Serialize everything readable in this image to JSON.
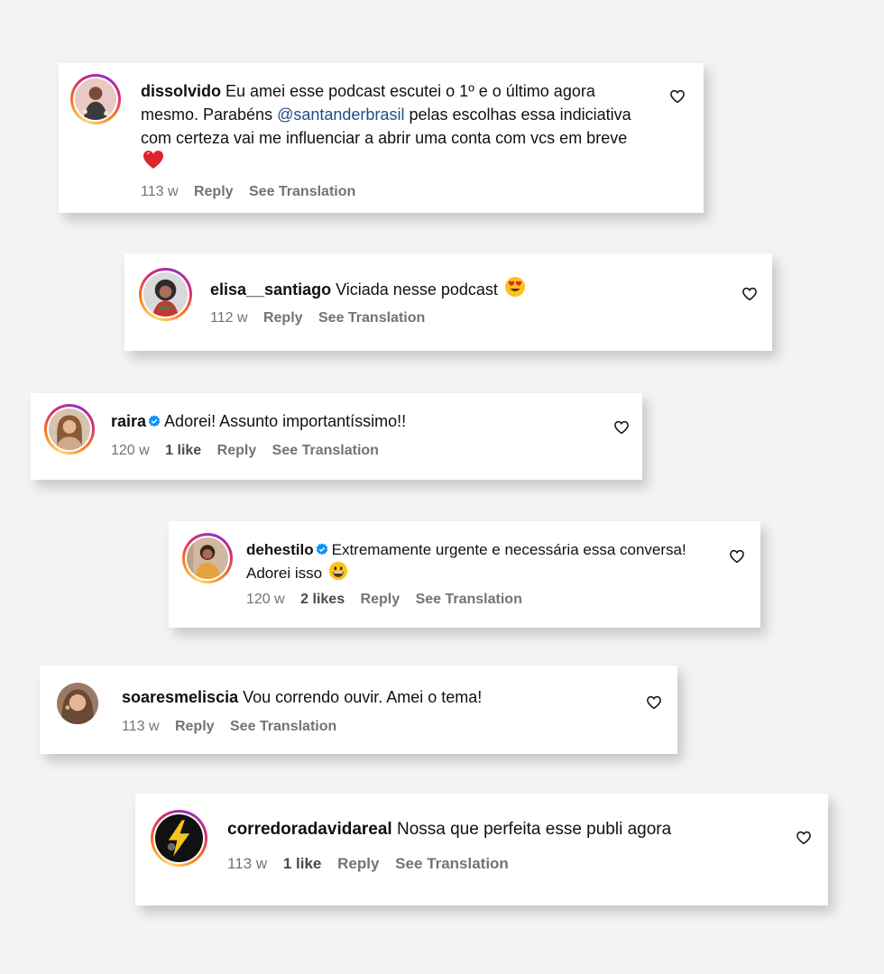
{
  "comments": [
    {
      "username": "dissolvido",
      "text_before": "Eu amei esse podcast escutei o 1º e o último agora mesmo. Parabéns",
      "mention": "@santanderbrasil",
      "text_after": "pelas escolhas essa indiciativa com certeza vai me influenciar a abrir uma conta com vcs em breve",
      "emoji": "red-heart",
      "time": "113 w",
      "reply": "Reply",
      "translate": "See Translation",
      "liked_icon": "heart-outline-icon"
    },
    {
      "username": "elisa__santiago",
      "text": "Viciada nesse podcast",
      "emoji": "heart-eyes",
      "time": "112 w",
      "reply": "Reply",
      "translate": "See Translation"
    },
    {
      "username": "raira",
      "verified": true,
      "text": "Adorei! Assunto importantíssimo!!",
      "time": "120 w",
      "likes": "1 like",
      "reply": "Reply",
      "translate": "See Translation"
    },
    {
      "username": "dehestilo",
      "verified": true,
      "text": "Extremamente urgente e necessária essa conversa! Adorei isso",
      "emoji": "grinning",
      "time": "120 w",
      "likes": "2 likes",
      "reply": "Reply",
      "translate": "See Translation"
    },
    {
      "username": "soaresmeliscia",
      "text": "Vou correndo ouvir. Amei o tema!",
      "time": "113 w",
      "reply": "Reply",
      "translate": "See Translation"
    },
    {
      "username": "corredoradavidareal",
      "text": "Nossa que perfeita esse publi agora",
      "time": "113 w",
      "likes": "1 like",
      "reply": "Reply",
      "translate": "See Translation"
    }
  ],
  "colors": {
    "mention": "#1f4e8c",
    "meta": "#737373",
    "verified": "#0095f6"
  }
}
